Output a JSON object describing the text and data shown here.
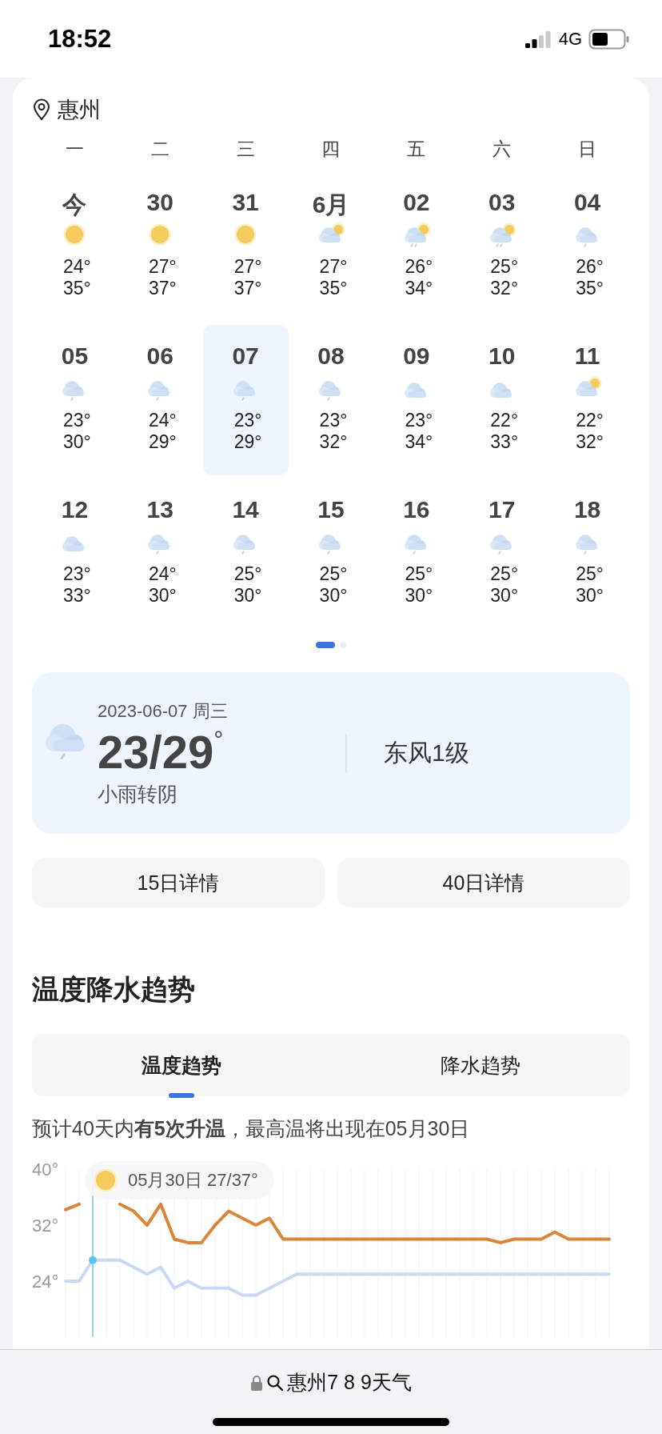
{
  "status_bar": {
    "time": "18:52",
    "network": "4G"
  },
  "calendar": {
    "city": "惠州",
    "weekdays": [
      "一",
      "二",
      "三",
      "四",
      "五",
      "六",
      "日"
    ],
    "days": [
      {
        "date": "今",
        "kind": "sunny",
        "low": "24°",
        "high": "35°",
        "selected": false
      },
      {
        "date": "30",
        "kind": "sunny",
        "low": "27°",
        "high": "37°",
        "selected": false
      },
      {
        "date": "31",
        "kind": "sunny",
        "low": "27°",
        "high": "37°",
        "selected": false
      },
      {
        "date": "6月",
        "kind": "partly-cloudy",
        "low": "27°",
        "high": "35°",
        "selected": false
      },
      {
        "date": "02",
        "kind": "sun-rain",
        "low": "26°",
        "high": "34°",
        "selected": false
      },
      {
        "date": "03",
        "kind": "sun-rain",
        "low": "25°",
        "high": "32°",
        "selected": false
      },
      {
        "date": "04",
        "kind": "rain",
        "low": "26°",
        "high": "35°",
        "selected": false
      },
      {
        "date": "05",
        "kind": "rain",
        "low": "23°",
        "high": "30°",
        "selected": false
      },
      {
        "date": "06",
        "kind": "rain",
        "low": "24°",
        "high": "29°",
        "selected": false
      },
      {
        "date": "07",
        "kind": "rain",
        "low": "23°",
        "high": "29°",
        "selected": true
      },
      {
        "date": "08",
        "kind": "rain",
        "low": "23°",
        "high": "32°",
        "selected": false
      },
      {
        "date": "09",
        "kind": "cloudy",
        "low": "23°",
        "high": "34°",
        "selected": false
      },
      {
        "date": "10",
        "kind": "cloudy",
        "low": "22°",
        "high": "33°",
        "selected": false
      },
      {
        "date": "11",
        "kind": "partly-cloudy",
        "low": "22°",
        "high": "32°",
        "selected": false
      },
      {
        "date": "12",
        "kind": "cloudy",
        "low": "23°",
        "high": "33°",
        "selected": false
      },
      {
        "date": "13",
        "kind": "rain",
        "low": "24°",
        "high": "30°",
        "selected": false
      },
      {
        "date": "14",
        "kind": "rain",
        "low": "25°",
        "high": "30°",
        "selected": false
      },
      {
        "date": "15",
        "kind": "rain",
        "low": "25°",
        "high": "30°",
        "selected": false
      },
      {
        "date": "16",
        "kind": "rain",
        "low": "25°",
        "high": "30°",
        "selected": false
      },
      {
        "date": "17",
        "kind": "rain",
        "low": "25°",
        "high": "30°",
        "selected": false
      },
      {
        "date": "18",
        "kind": "rain",
        "low": "25°",
        "high": "30°",
        "selected": false
      }
    ],
    "pager": [
      {
        "selected": true
      },
      {
        "selected": false
      }
    ]
  },
  "detail": {
    "date": "2023-06-07 周三",
    "kind": "rain",
    "temp": "23/29$^{°}$",
    "weather": "小雨转阴",
    "wind": "东风1级"
  },
  "buttons": [
    "15日详情",
    "40日详情"
  ],
  "trend": {
    "title": "温度降水趋势",
    "tabs": [
      {
        "label": "温度趋势",
        "selected": true
      },
      {
        "label": "降水趋势",
        "selected": false
      }
    ],
    "summary": "预计40天内**有5次升温**，最高温将出现在05月30日",
    "tooltip": "05月30日 27/37°",
    "chart_data": {
      "type": "line",
      "grid": true,
      "ylim": [
        16,
        40
      ],
      "yticks": [
        {
          "value": 24,
          "label": "24°"
        },
        {
          "value": 32,
          "label": "32°"
        },
        {
          "value": 40,
          "label": "40°"
        }
      ],
      "series": [
        {
          "color": "#d9863a",
          "values": [
            34.2,
            35,
            null,
            null,
            35,
            34,
            32,
            35,
            30,
            29.5,
            29.5,
            32,
            34,
            33,
            32,
            33,
            30,
            30,
            30,
            30,
            30,
            30,
            30,
            30,
            30,
            30,
            30,
            30,
            30,
            30,
            30,
            30,
            29.5,
            30,
            30,
            30,
            31,
            30,
            30,
            30,
            30
          ]
        },
        {
          "color": "#c7d9f3",
          "values": [
            24,
            24,
            27,
            27,
            27,
            26,
            25,
            26,
            23,
            24,
            23,
            23,
            23,
            22,
            22,
            23,
            24,
            25,
            25,
            25,
            25,
            25,
            25,
            25,
            25,
            25,
            25,
            25,
            25,
            25,
            25,
            25,
            25,
            25,
            25,
            25,
            25,
            25,
            25,
            25,
            25
          ]
        }
      ]
    }
  },
  "address_bar": {
    "text": "惠州7 8 9天气"
  }
}
